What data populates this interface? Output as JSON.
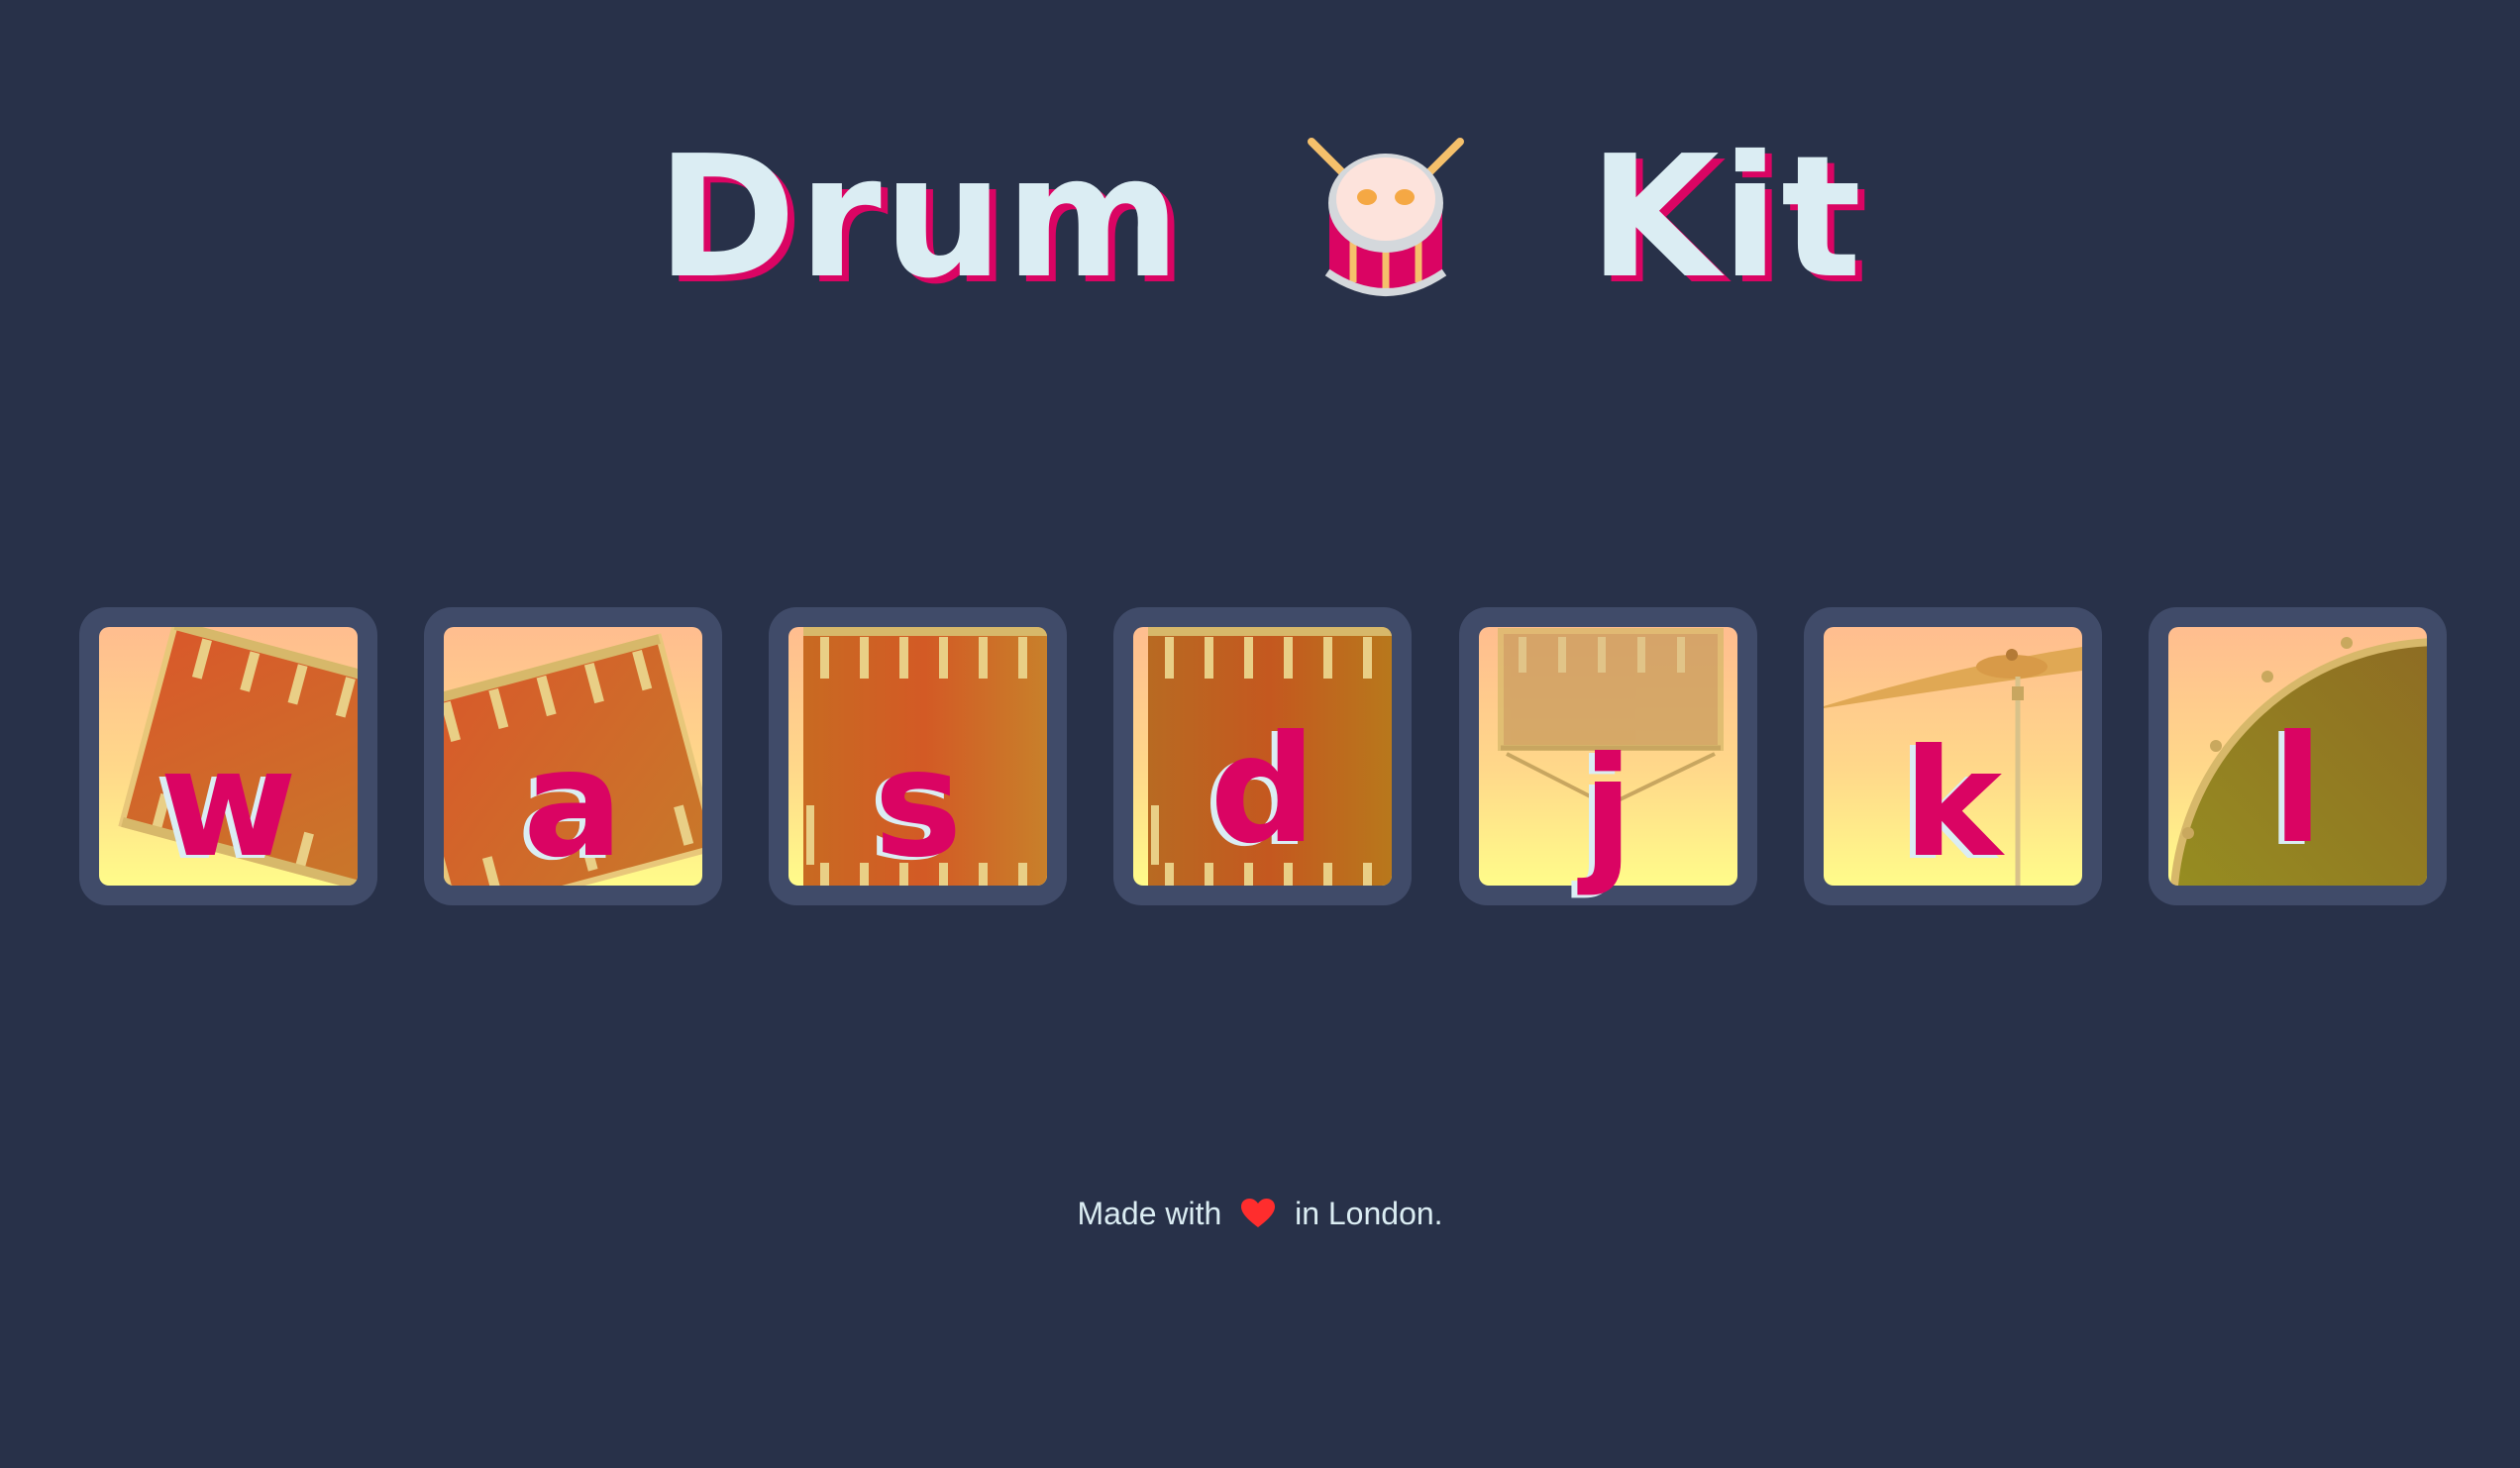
{
  "title": {
    "word_left": "Drum",
    "icon": "drum-icon",
    "word_right": "Kit"
  },
  "keys": [
    {
      "letter": "w",
      "art": "tom-tilted-left-icon"
    },
    {
      "letter": "a",
      "art": "tom-tilted-right-icon"
    },
    {
      "letter": "s",
      "art": "snare-side-icon"
    },
    {
      "letter": "d",
      "art": "snare-side-icon"
    },
    {
      "letter": "j",
      "art": "snare-on-stand-icon"
    },
    {
      "letter": "k",
      "art": "cymbal-icon"
    },
    {
      "letter": "l",
      "art": "bass-drum-icon"
    }
  ],
  "footer": {
    "before": "Made with",
    "icon": "heart-icon",
    "after": "in London."
  },
  "colors": {
    "background": "#283149",
    "key_frame": "#404b69",
    "accent": "#da0463",
    "text_light": "#dbedf3",
    "heart": "#ff2d2d"
  }
}
